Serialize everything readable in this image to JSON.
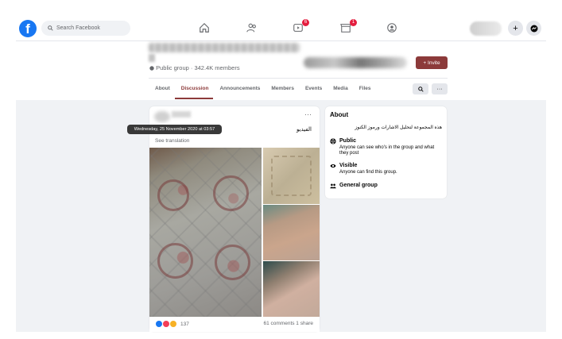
{
  "topbar": {
    "logo": "f",
    "search_placeholder": "Search Facebook",
    "nav": [
      {
        "icon": "home-icon"
      },
      {
        "icon": "friends-icon"
      },
      {
        "icon": "watch-icon",
        "badge": "6"
      },
      {
        "icon": "marketplace-icon",
        "badge": "1"
      },
      {
        "icon": "groups-icon"
      }
    ],
    "add_label": "+",
    "messenger_label": "●"
  },
  "group": {
    "meta": "Public group · 342.4K members",
    "invite_label": "+ Invite",
    "tabs": [
      "About",
      "Discussion",
      "Announcements",
      "Members",
      "Events",
      "Media",
      "Files"
    ],
    "active_tab": "Discussion",
    "search_btn": "🔍",
    "more_btn": "···"
  },
  "post": {
    "more": "···",
    "text": "الفيديو",
    "see_translation": "See translation",
    "tooltip": "Wednesday, 25 November 2020 at 03:57",
    "reactions_count": "137",
    "comments_shares": "61 comments  1 share"
  },
  "about": {
    "title": "About",
    "description": "هذه المجموعة لتحليل الاشارات ورموز الكنوز",
    "rows": [
      {
        "heading": "Public",
        "sub": "Anyone can see who's in the group and what they post"
      },
      {
        "heading": "Visible",
        "sub": "Anyone can find this group."
      },
      {
        "heading": "General group",
        "sub": ""
      }
    ]
  },
  "colors": {
    "brand": "#1877f2",
    "accent": "#8c3a3a",
    "badge": "#e41e3f",
    "background": "#f0f2f5"
  }
}
